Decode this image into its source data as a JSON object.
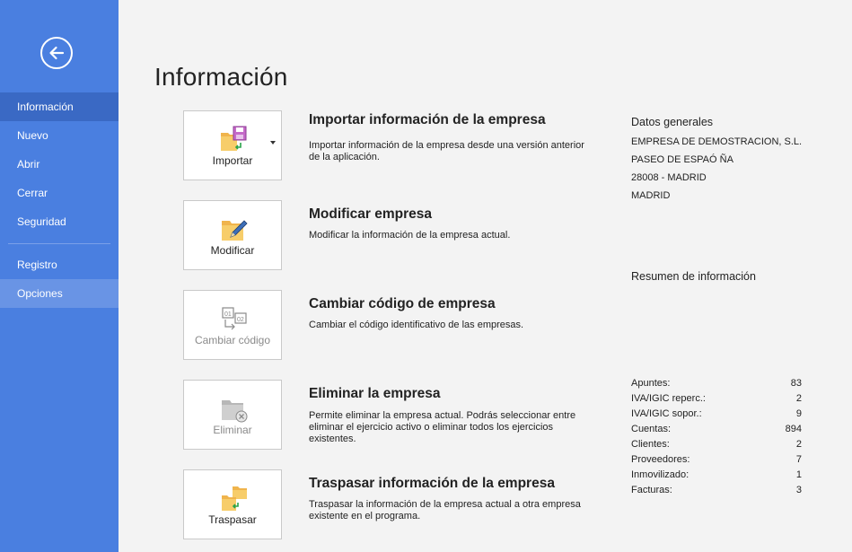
{
  "sidebar": {
    "items": [
      {
        "label": "Información"
      },
      {
        "label": "Nuevo"
      },
      {
        "label": "Abrir"
      },
      {
        "label": "Cerrar"
      },
      {
        "label": "Seguridad"
      },
      {
        "label": "Registro"
      },
      {
        "label": "Opciones"
      }
    ]
  },
  "page": {
    "title": "Información"
  },
  "actions": [
    {
      "tile_label": "Importar",
      "title": "Importar información de la empresa",
      "description": "Importar información de la empresa desde una versión anterior de la aplicación.",
      "icon": "folder-disk-import-icon"
    },
    {
      "tile_label": "Modificar",
      "title": "Modificar empresa",
      "description": "Modificar la información de la empresa actual.",
      "icon": "folder-pencil-icon"
    },
    {
      "tile_label": "Cambiar código",
      "title": "Cambiar código de empresa",
      "description": "Cambiar el código identificativo de las empresas.",
      "icon": "change-code-icon"
    },
    {
      "tile_label": "Eliminar",
      "title": "Eliminar la empresa",
      "description": "Permite eliminar la empresa actual. Podrás seleccionar entre eliminar el ejercicio activo o eliminar todos los ejercicios existentes.",
      "icon": "folder-delete-icon"
    },
    {
      "tile_label": "Traspasar",
      "title": "Traspasar información de la empresa",
      "description": "Traspasar la información de la empresa actual a otra empresa existente en el programa.",
      "icon": "folder-transfer-icon"
    }
  ],
  "general": {
    "heading": "Datos generales",
    "lines": [
      "EMPRESA DE DEMOSTRACION, S.L.",
      "PASEO DE ESPAÓ ÑA",
      "28008 - MADRID",
      "MADRID"
    ]
  },
  "summary": {
    "heading": "Resumen de información",
    "rows": [
      {
        "label": "Apuntes:",
        "value": "83"
      },
      {
        "label": "IVA/IGIC reperc.:",
        "value": "2"
      },
      {
        "label": "IVA/IGIC sopor.:",
        "value": "9"
      },
      {
        "label": "Cuentas:",
        "value": "894"
      },
      {
        "label": "Clientes:",
        "value": "2"
      },
      {
        "label": "Proveedores:",
        "value": "7"
      },
      {
        "label": "Inmovilizado:",
        "value": "1"
      },
      {
        "label": "Facturas:",
        "value": "3"
      }
    ]
  },
  "colors": {
    "sidebar": "#4a7fe0",
    "sidebar_active": "#3a69c4",
    "sidebar_hover": "#6994e5",
    "background": "#f3f3f3"
  }
}
